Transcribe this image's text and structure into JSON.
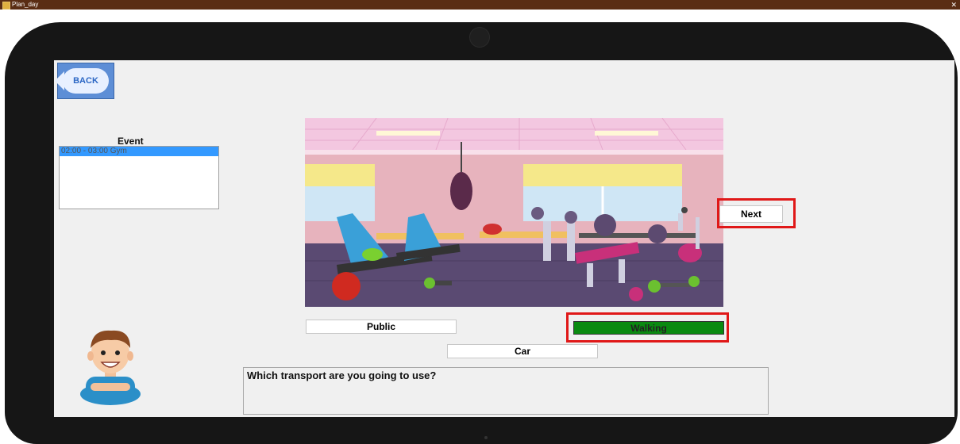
{
  "window": {
    "title": "Plan_day",
    "close_glyph": "✕"
  },
  "navigation": {
    "back_label": "BACK"
  },
  "events": {
    "label": "Event",
    "items": [
      {
        "text": "02:00 - 03:00  Gym",
        "selected": true
      }
    ]
  },
  "scene": {
    "image": "gym-illustration",
    "next_label": "Next"
  },
  "transport": {
    "options": {
      "public": "Public",
      "walking": "Walking",
      "car": "Car"
    },
    "selected": "Walking",
    "selected_color": "#0a8a10",
    "highlight_color": "#e01818"
  },
  "prompt": {
    "question": "Which transport are you going to use?"
  }
}
